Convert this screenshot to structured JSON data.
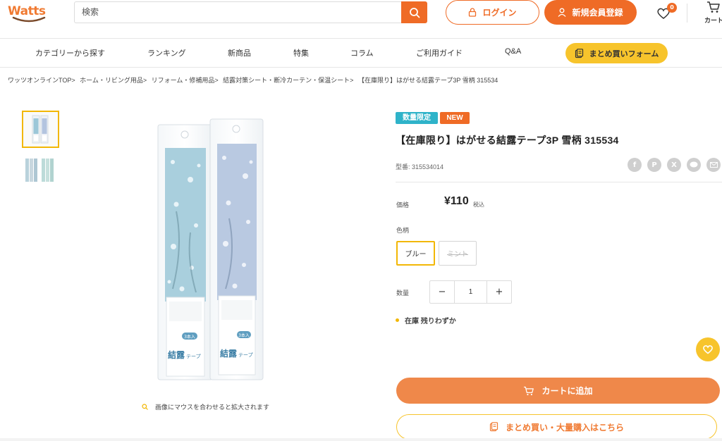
{
  "header": {
    "logo_text": "Watts",
    "search_placeholder": "検索",
    "login_label": "ログイン",
    "register_label": "新規会員登録",
    "wishlist_count": "0",
    "cart_label": "カート"
  },
  "nav": {
    "items": [
      "カテゴリーから探す",
      "ランキング",
      "新商品",
      "特集",
      "コラム",
      "ご利用ガイド",
      "Q&A"
    ],
    "bulk_form_label": "まとめ買いフォーム"
  },
  "breadcrumb": [
    "ワッツオンラインTOP>",
    "ホーム・リビング用品>",
    "リフォーム・修補用品>",
    "結露対策シート・断冷カーテン・保温シート>",
    "【在庫限り】はがせる結露テープ3P 雪柄 315534"
  ],
  "gallery": {
    "zoom_hint": "画像にマウスを合わせると拡大されます",
    "package_title": "結露",
    "package_sub": "テープ",
    "package_tag": "3本入"
  },
  "product": {
    "badge_limited": "数量限定",
    "badge_new": "NEW",
    "title": "【在庫限り】はがせる結露テープ3P 雪柄 315534",
    "model": "型番: 315534014",
    "price_label": "価格",
    "price": "¥110",
    "tax_label": "税込",
    "color_label": "色柄",
    "colors": [
      "ブルー",
      "ミント"
    ],
    "quantity_label": "数量",
    "quantity": "1",
    "qty_minus": "−",
    "qty_plus": "+",
    "stock_text": "在庫 残りわずか",
    "add_to_cart": "カートに追加",
    "bulk_buy": "まとめ買い・大量購入はこちら"
  },
  "share_icons": [
    "facebook-icon",
    "pinterest-icon",
    "x-icon",
    "line-icon",
    "mail-icon"
  ],
  "colors": {
    "accent_orange": "#ef6b26",
    "accent_yellow": "#f7c42c",
    "badge_teal": "#2fb3c9"
  }
}
